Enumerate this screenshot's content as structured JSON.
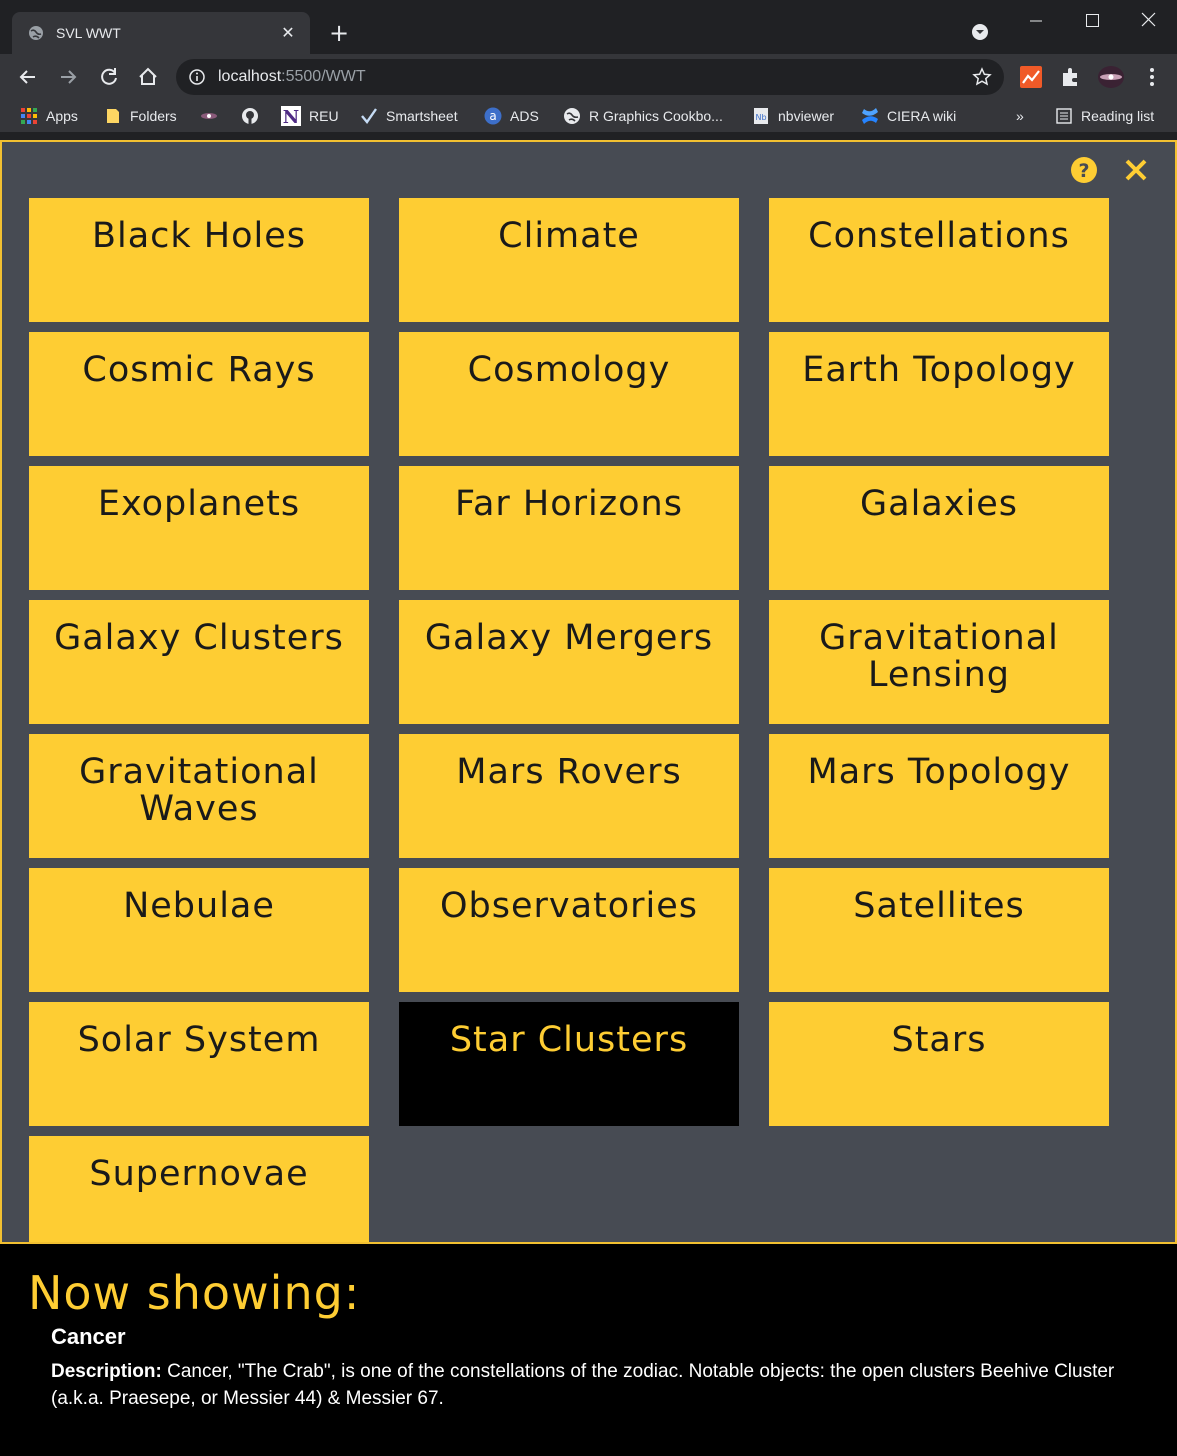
{
  "browser": {
    "tab_title": "SVL WWT",
    "url_host": "localhost",
    "url_rest": ":5500/WWT",
    "bookmarks": {
      "apps": "Apps",
      "folders": "Folders",
      "reu": "REU",
      "smartsheet": "Smartsheet",
      "ads": "ADS",
      "r_graphics": "R Graphics Cookbo...",
      "nbviewer": "nbviewer",
      "ciera": "CIERA wiki",
      "overflow": "»",
      "reading_list": "Reading list"
    }
  },
  "tiles": [
    "Black Holes",
    "Climate",
    "Constellations",
    "Cosmic Rays",
    "Cosmology",
    "Earth Topology",
    "Exoplanets",
    "Far Horizons",
    "Galaxies",
    "Galaxy Clusters",
    "Galaxy Mergers",
    "Gravitational Lensing",
    "Gravitational Waves",
    "Mars Rovers",
    "Mars Topology",
    "Nebulae",
    "Observatories",
    "Satellites",
    "Solar System",
    "Star Clusters",
    "Stars",
    "Supernovae"
  ],
  "active_tile": "Star Clusters",
  "colors": {
    "accent": "#fecd33",
    "panel": "#474b53"
  },
  "now_showing": {
    "heading": "Now showing:",
    "name": "Cancer",
    "desc_label": "Description:",
    "desc_text": " Cancer, \"The Crab\", is one of the constellations of the zodiac. Notable objects: the open clusters Beehive Cluster (a.k.a. Praesepe, or Messier 44) & Messier 67."
  }
}
